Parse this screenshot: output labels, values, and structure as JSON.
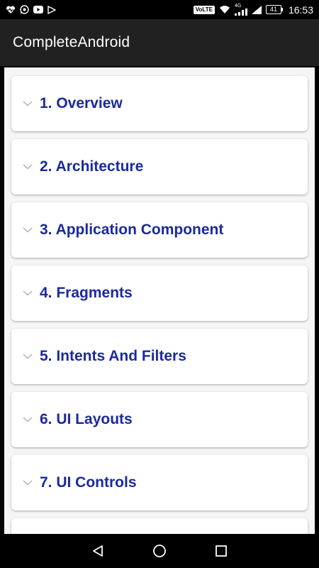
{
  "status_bar": {
    "network_label": "4G",
    "volte_label": "VoLTE",
    "battery": "41",
    "time": "16:53"
  },
  "app_bar": {
    "title": "CompleteAndroid"
  },
  "topics": [
    {
      "label": "1. Overview"
    },
    {
      "label": "2. Architecture"
    },
    {
      "label": "3. Application Component"
    },
    {
      "label": "4. Fragments"
    },
    {
      "label": "5. Intents And Filters"
    },
    {
      "label": "6. UI Layouts"
    },
    {
      "label": "7. UI Controls"
    },
    {
      "label": ""
    }
  ],
  "colors": {
    "topic_text": "#1a2a9c",
    "app_bar": "#212121",
    "list_bg": "#f5f5f5"
  },
  "icons": {
    "expand": "chevron-down-icon",
    "nav_back": "back-triangle-icon",
    "nav_home": "home-circle-icon",
    "nav_recents": "recents-square-icon"
  }
}
